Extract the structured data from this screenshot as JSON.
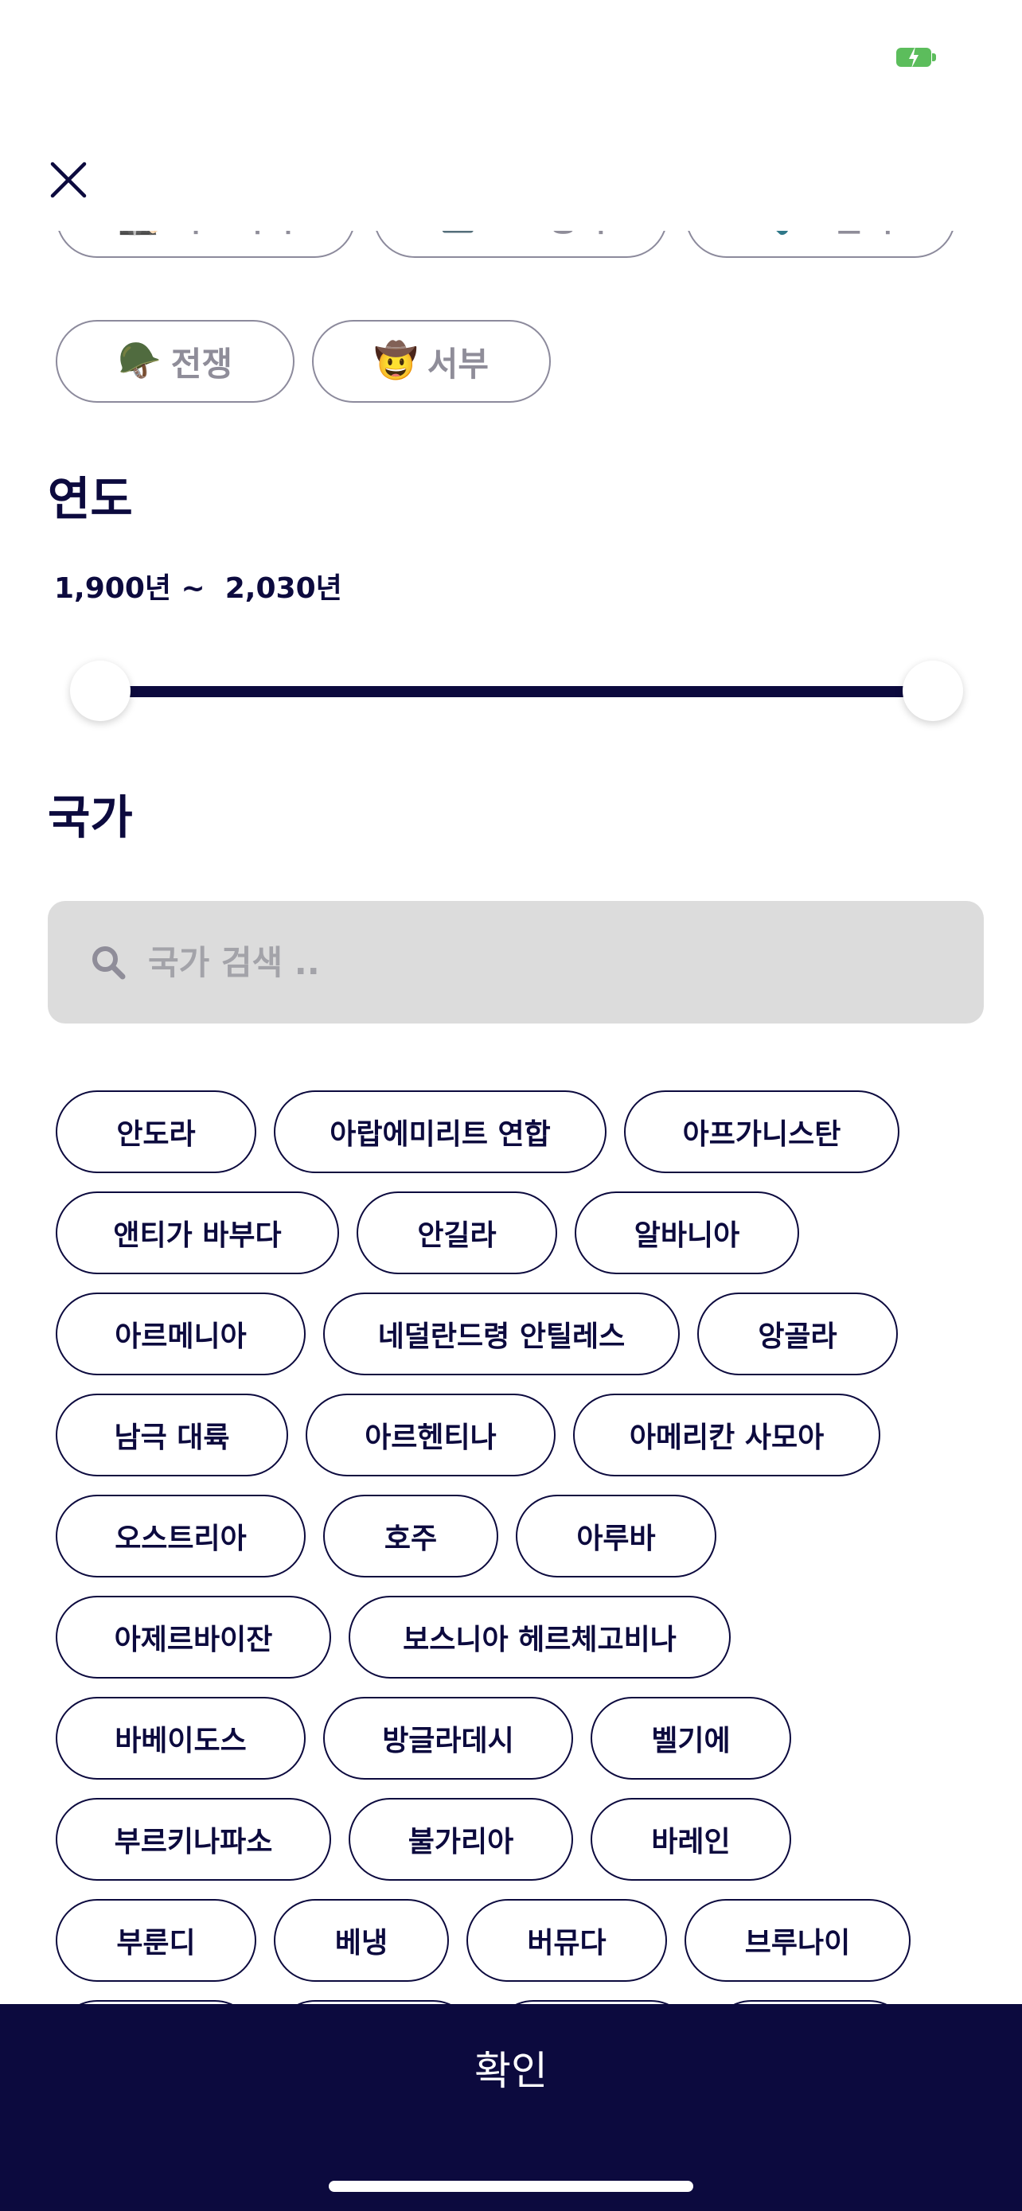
{
  "status": {
    "battery_icon": "charging-battery-icon",
    "battery_color": "#5cbd5c"
  },
  "header": {
    "close_icon": "close-icon"
  },
  "genres": [
    {
      "emoji": "🕵🏻",
      "label": "미스터리"
    },
    {
      "emoji": "📹",
      "label": "TV 영화"
    },
    {
      "emoji": "🔦",
      "label": "스릴러"
    },
    {
      "emoji": "🪖",
      "label": "전쟁"
    },
    {
      "emoji": "🤠",
      "label": "서부"
    }
  ],
  "year": {
    "title": "연도",
    "range_text": "1,900년 ~  2,030년",
    "min": 1900,
    "max": 2030
  },
  "country": {
    "title": "국가",
    "search_placeholder": "국가 검색 ..",
    "search_value": "",
    "items": [
      "안도라",
      "아랍에미리트 연합",
      "아프가니스탄",
      "앤티가 바부다",
      "안길라",
      "알바니아",
      "아르메니아",
      "네덜란드령 안틸레스",
      "앙골라",
      "남극 대륙",
      "아르헨티나",
      "아메리칸 사모아",
      "오스트리아",
      "호주",
      "아루바",
      "아제르바이잔",
      "보스니아 헤르체고비나",
      "바베이도스",
      "방글라데시",
      "벨기에",
      "부르키나파소",
      "불가리아",
      "바레인",
      "부룬디",
      "베냉",
      "버뮤다",
      "브루나이"
    ]
  },
  "footer": {
    "confirm_label": "확인"
  },
  "colors": {
    "primary": "#0c0a3e",
    "search_bg": "#dcdcdc",
    "muted": "#8f8d99"
  }
}
